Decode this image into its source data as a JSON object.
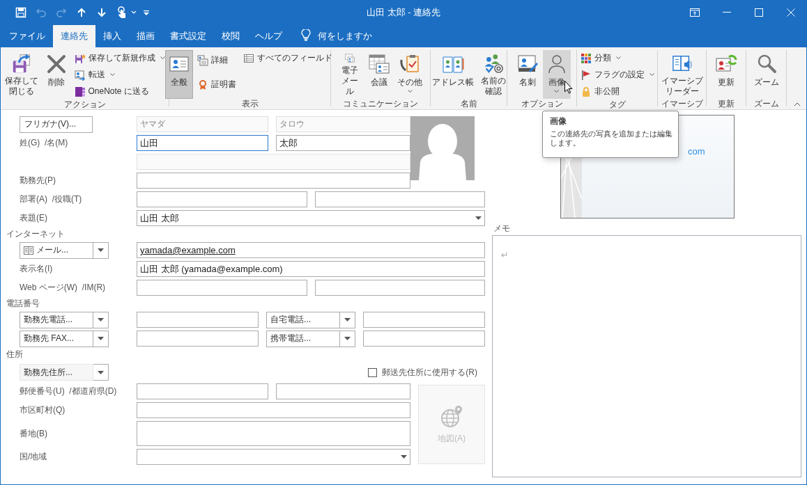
{
  "window": {
    "title": "山田 太郎 - 連絡先"
  },
  "quick_access": [
    {
      "disabled": false
    },
    {
      "disabled": true
    },
    {
      "disabled": true
    },
    {
      "disabled": false
    },
    {
      "disabled": false
    },
    {
      "disabled": false
    }
  ],
  "tabs": [
    {
      "label": "ファイル",
      "selected": false
    },
    {
      "label": "連絡先",
      "selected": true
    },
    {
      "label": "挿入",
      "selected": false
    },
    {
      "label": "描画",
      "selected": false
    },
    {
      "label": "書式設定",
      "selected": false
    },
    {
      "label": "校閲",
      "selected": false
    },
    {
      "label": "ヘルプ",
      "selected": false
    }
  ],
  "tell_me": "何をしますか",
  "ribbon": {
    "groups": [
      {
        "label": "アクション",
        "columns": [
          [
            {
              "label": "保存して閉じる",
              "kind": "large"
            }
          ],
          [
            {
              "label": "削除",
              "kind": "large"
            }
          ],
          [
            {
              "label": "保存して新規作成",
              "kind": "small",
              "dropdown": true
            },
            {
              "label": "転送",
              "kind": "small",
              "dropdown": true
            },
            {
              "label": "OneNote に送る",
              "kind": "small"
            }
          ]
        ]
      },
      {
        "label": "表示",
        "columns": [
          [
            {
              "label": "全般",
              "kind": "large",
              "selected": true
            }
          ],
          [
            {
              "label": "詳細",
              "kind": "small",
              "selected": false
            },
            {
              "label": "証明書",
              "kind": "small",
              "selected": false
            }
          ],
          [
            {
              "label": "すべてのフィールド",
              "kind": "small",
              "selected": false
            }
          ]
        ]
      },
      {
        "label": "コミュニケーション",
        "columns": [
          [
            {
              "label": "電子メール",
              "kind": "large"
            }
          ],
          [
            {
              "label": "会議",
              "kind": "large"
            }
          ],
          [
            {
              "label": "その他",
              "kind": "large",
              "dropdown": true
            }
          ]
        ]
      },
      {
        "label": "名前",
        "columns": [
          [
            {
              "label": "アドレス帳",
              "kind": "large"
            }
          ],
          [
            {
              "label": "名前の確認",
              "kind": "large"
            }
          ]
        ]
      },
      {
        "label": "オプション",
        "columns": [
          [
            {
              "label": "名刺",
              "kind": "large",
              "hovered": false
            }
          ],
          [
            {
              "label": "画像",
              "kind": "large",
              "dropdown": true,
              "hovered": true
            }
          ]
        ]
      },
      {
        "label": "タグ",
        "columns": [
          [
            {
              "label": "分類",
              "kind": "small",
              "dropdown": true
            },
            {
              "label": "フラグの設定",
              "kind": "small",
              "dropdown": true
            },
            {
              "label": "非公開",
              "kind": "small"
            }
          ]
        ]
      },
      {
        "label": "イマーシブ",
        "columns": [
          [
            {
              "label": "イマーシブリーダー",
              "kind": "large"
            }
          ]
        ]
      },
      {
        "label": "更新",
        "columns": [
          [
            {
              "label": "更新",
              "kind": "large"
            }
          ]
        ]
      },
      {
        "label": "ズーム",
        "columns": [
          [
            {
              "label": "ズーム",
              "kind": "large"
            }
          ]
        ]
      }
    ]
  },
  "form": {
    "furigana_button": "フリガナ(V)...",
    "furigana_last": "ヤマダ",
    "furigana_first": "タロウ",
    "name": {
      "label": "姓(G)  /名(M)",
      "last": "山田",
      "first": "太郎",
      "last_focused": true
    },
    "company_label": "勤務先(P)",
    "dept_label": "部署(A)  /役職(T)",
    "file_as": {
      "label": "表題(E)",
      "value": "山田 太郎"
    },
    "internet": {
      "label": "インターネット",
      "email_type": "メール...",
      "email": "yamada@example.com",
      "display_name_label": "表示名(I)",
      "display_name": "山田 太郎 (yamada@example.com)",
      "web_label": "Web ページ(W)  /IM(R)"
    },
    "phones": {
      "label": "電話番号",
      "entries": [
        {
          "type": "勤務先電話..."
        },
        {
          "type": "自宅電話..."
        },
        {
          "type": "勤務先 FAX..."
        },
        {
          "type": "携帯電話..."
        }
      ]
    },
    "address": {
      "label": "住所",
      "type": "勤務先住所...",
      "mailing": {
        "label": "郵送先住所に使用する(R)",
        "checked": false
      },
      "postal_label": "郵便番号(U)  /都道府県(D)",
      "city_label": "市区町村(Q)",
      "street_label": "番地(B)",
      "country_label": "国/地域",
      "map_button": {
        "label": "地図(A)",
        "disabled": true
      }
    }
  },
  "business_card": {
    "text": "com"
  },
  "notes": {
    "label": "メモ",
    "text": "↵"
  },
  "tooltip": {
    "title": "画像",
    "text": "この連絡先の写真を追加または編集します。"
  }
}
